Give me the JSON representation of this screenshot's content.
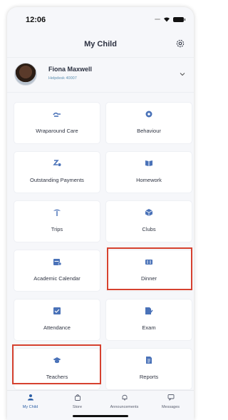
{
  "status": {
    "time": "12:06"
  },
  "header": {
    "title": "My Child",
    "settings_icon": "gear-icon"
  },
  "profile": {
    "name": "Fiona Maxwell",
    "subtitle": "Helpdesk 40007",
    "expand_icon": "chevron-down-icon"
  },
  "tiles": [
    {
      "label": "Wraparound Care",
      "icon": "handshake-icon"
    },
    {
      "label": "Behaviour",
      "icon": "badge-icon"
    },
    {
      "label": "Outstanding Payments",
      "icon": "payment-icon"
    },
    {
      "label": "Homework",
      "icon": "book-icon"
    },
    {
      "label": "Trips",
      "icon": "palm-tree-icon"
    },
    {
      "label": "Clubs",
      "icon": "cube-icon"
    },
    {
      "label": "Academic Calendar",
      "icon": "calendar-icon"
    },
    {
      "label": "Dinner",
      "icon": "cutlery-icon"
    },
    {
      "label": "Attendance",
      "icon": "register-icon"
    },
    {
      "label": "Exam",
      "icon": "pencil-icon"
    },
    {
      "label": "Teachers",
      "icon": "graduation-cap-icon"
    },
    {
      "label": "Reports",
      "icon": "document-icon"
    }
  ],
  "tabbar": [
    {
      "label": "My Child",
      "icon": "person-icon",
      "active": true
    },
    {
      "label": "Store",
      "icon": "shopping-bag-icon",
      "active": false
    },
    {
      "label": "Announcements",
      "icon": "bell-icon",
      "active": false
    },
    {
      "label": "Messages",
      "icon": "chat-icon",
      "active": false
    }
  ],
  "colors": {
    "accent": "#2d5fa5",
    "highlight": "#d6412f",
    "icon": "#4a72b8"
  }
}
